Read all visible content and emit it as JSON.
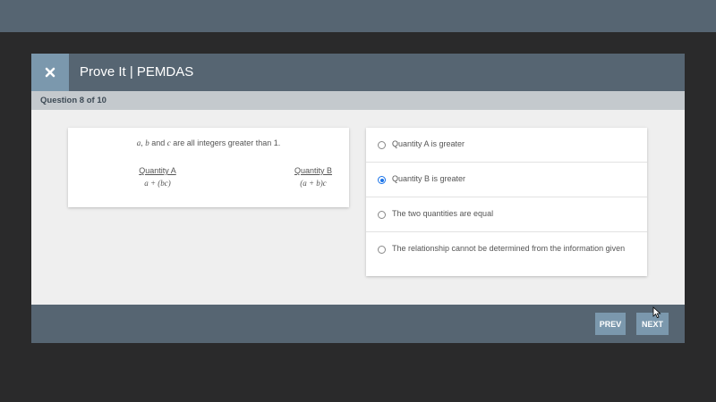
{
  "modal": {
    "title": "Prove It | PEMDAS",
    "close_icon": "close-x-icon"
  },
  "question_bar": {
    "text": "Question 8 of 10"
  },
  "question": {
    "stem_var_a": "a",
    "stem_sep_1": ", ",
    "stem_var_b": "b",
    "stem_sep_2": " and ",
    "stem_var_c": "c",
    "stem_rest": " are all integers greater than 1.",
    "quantity_a_label": "Quantity A",
    "quantity_a_expr": "a + (bc)",
    "quantity_b_label": "Quantity B",
    "quantity_b_expr": "(a + b)c"
  },
  "options": [
    {
      "label": "Quantity A is greater",
      "selected": false
    },
    {
      "label": "Quantity B is greater",
      "selected": true
    },
    {
      "label": "The two quantities are equal",
      "selected": false
    },
    {
      "label": "The relationship cannot be determined from the information given",
      "selected": false
    }
  ],
  "footer": {
    "prev_label": "PREV",
    "next_label": "NEXT"
  },
  "colors": {
    "header": "#566572",
    "accent_button": "#7b98ad",
    "radio_selected": "#1a73e8",
    "background": "#2a2a2b"
  }
}
